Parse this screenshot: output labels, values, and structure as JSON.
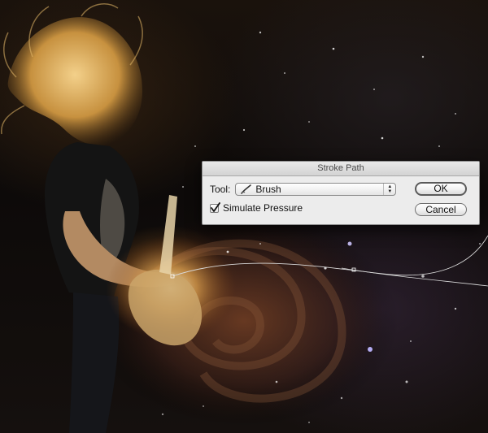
{
  "dialog": {
    "title": "Stroke Path",
    "tool_label": "Tool:",
    "tool_value": "Brush",
    "tool_icon": "brush-icon",
    "simulate_pressure_label": "Simulate Pressure",
    "simulate_pressure_checked": true,
    "ok_label": "OK",
    "cancel_label": "Cancel"
  },
  "artwork": {
    "subject": "guitarist with flowing hair over galaxy background",
    "path_color": "#d9d9d9"
  }
}
